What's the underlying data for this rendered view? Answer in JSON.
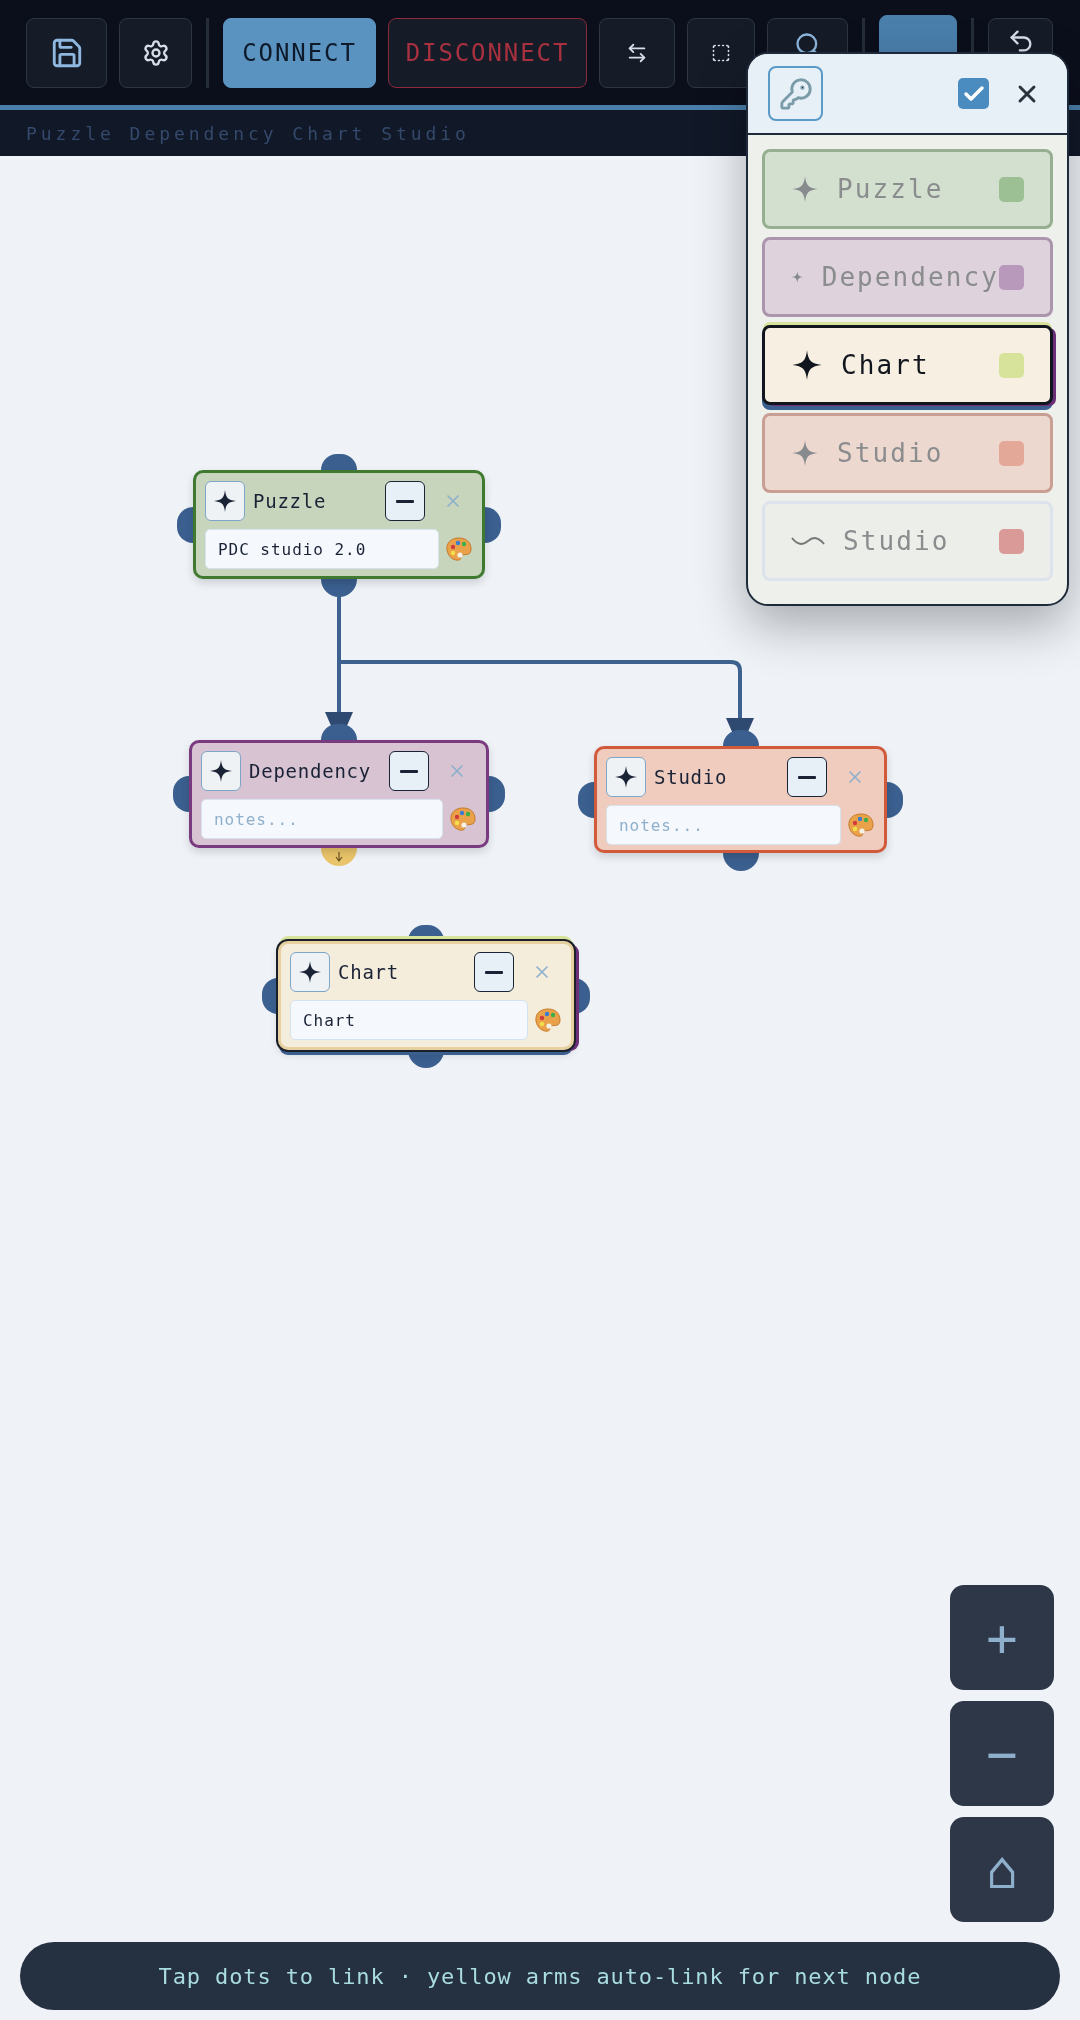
{
  "toolbar": {
    "buttons": [
      {
        "kind": "save"
      },
      {
        "kind": "settings"
      },
      {
        "kind": "primary",
        "label": "CONNECT"
      },
      {
        "kind": "danger",
        "label": "DISCONNECT"
      },
      {
        "kind": "swap"
      },
      {
        "kind": "select"
      },
      {
        "kind": "search"
      },
      {
        "kind": "accent"
      },
      {
        "kind": "undo"
      }
    ]
  },
  "subtitle": "Puzzle Dependency Chart Studio",
  "nodes": [
    {
      "title": "Puzzle",
      "value": "PDC studio 2.0",
      "color": "#3f7a30",
      "selected": false,
      "armed": false
    },
    {
      "title": "Dependency",
      "placeholder": "notes...",
      "color": "#7a3a80",
      "selected": false,
      "armed": true
    },
    {
      "title": "Studio",
      "placeholder": "notes...",
      "color": "#d05a3a",
      "selected": false,
      "armed": false
    },
    {
      "title": "Chart",
      "value": "Chart",
      "color": "#e6d0a0",
      "selected": true,
      "armed": false
    }
  ],
  "palette_panel": {
    "checked": true,
    "items": [
      {
        "label": "Puzzle",
        "kind": "sparkle",
        "color": "#9dbf94",
        "selected": false
      },
      {
        "label": "Dependency",
        "kind": "sparkle",
        "color": "#b899bb",
        "selected": false
      },
      {
        "label": "Chart",
        "kind": "sparkle",
        "color": "#d7e39a",
        "selected": true
      },
      {
        "label": "Studio",
        "kind": "sparkle",
        "color": "#e4a898",
        "selected": false
      },
      {
        "label": "Studio",
        "kind": "wave",
        "color": "#d99a98",
        "selected": false
      }
    ]
  },
  "zoom_controls": [
    "+",
    "−",
    "⌂"
  ],
  "hint": "Tap dots to link · yellow arms auto-link for next node"
}
